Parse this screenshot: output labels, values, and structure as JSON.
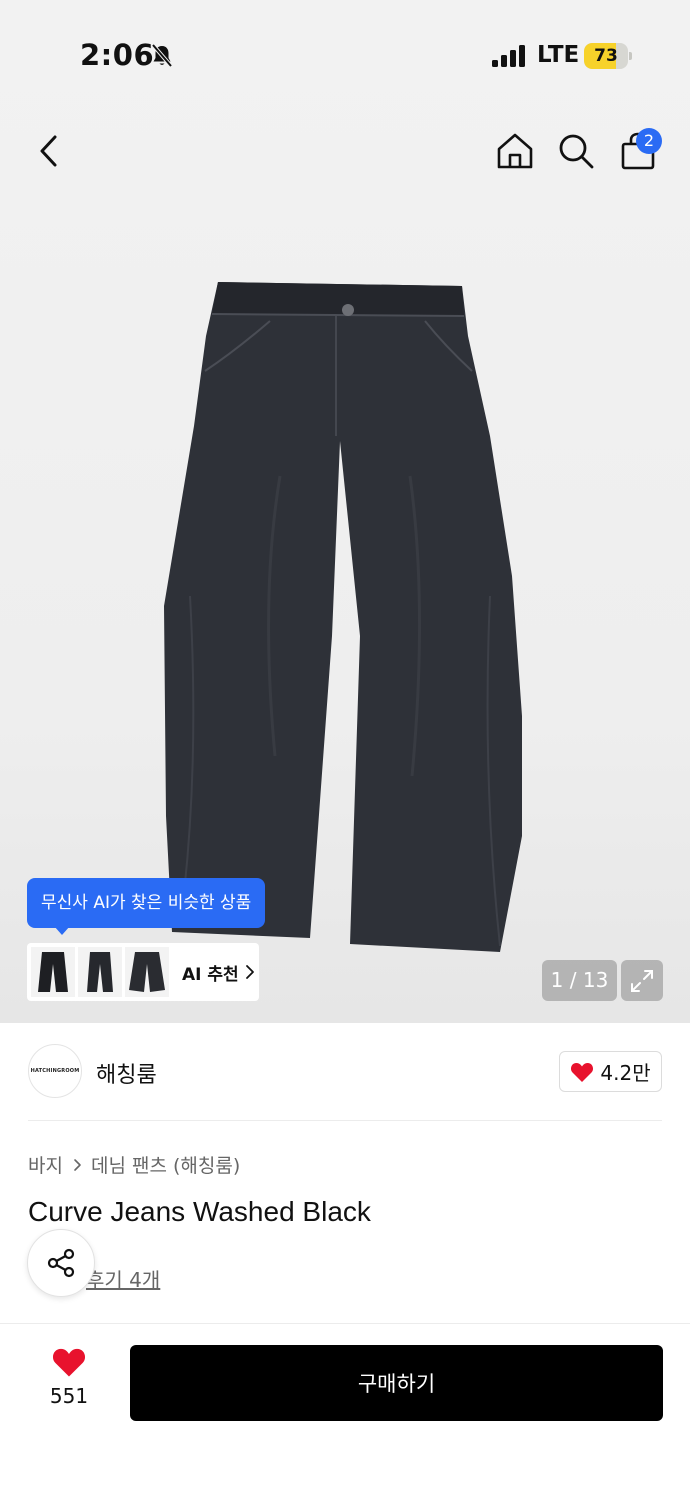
{
  "status_bar": {
    "time": "2:06",
    "network": "LTE",
    "battery": "73",
    "battery_level": 0.73,
    "icons": [
      "bell-slash-icon",
      "signal-icon",
      "battery-icon"
    ]
  },
  "nav": {
    "cart_badge": "2",
    "icons": [
      "back-chevron-icon",
      "home-icon",
      "search-icon",
      "shopping-bag-icon"
    ]
  },
  "gallery": {
    "ai_tooltip": "무신사 AI가 찾은 비슷한 상품",
    "ai_recommend_label": "AI 추천",
    "page_indicator": "1 / 13"
  },
  "brand": {
    "logo_text": "HATCHINGROOM",
    "name": "해칭룸",
    "likes": "4.2만"
  },
  "breadcrumb": {
    "category": "바지",
    "subcategory": "데님 팬츠 (해칭룸)"
  },
  "product": {
    "title": "Curve Jeans Washed Black",
    "review_link": "후기 4개"
  },
  "bottom_bar": {
    "wish_count": "551",
    "buy_label": "구매하기"
  },
  "colors": {
    "accent_blue": "#2a6bf4",
    "heart_red": "#e8122d",
    "battery_yellow": "#f7d22a"
  }
}
